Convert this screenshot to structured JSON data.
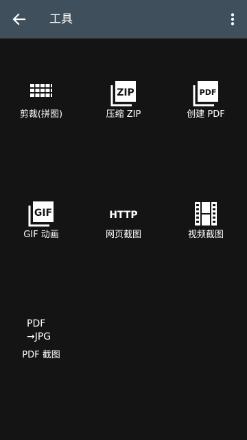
{
  "header": {
    "title": "工具"
  },
  "tools": [
    {
      "label": "剪裁(拼图)",
      "icon": "grid-icon"
    },
    {
      "label": "压缩 ZIP",
      "icon": "zip-icon",
      "badge": "ZIP"
    },
    {
      "label": "创建 PDF",
      "icon": "pdf-icon",
      "badge": "PDF"
    },
    {
      "label": "GIF 动画",
      "icon": "gif-icon",
      "badge": "GIF"
    },
    {
      "label": "网页截图",
      "icon": "http-icon",
      "badge": "HTTP"
    },
    {
      "label": "视频截图",
      "icon": "film-icon"
    },
    {
      "label": "PDF 截图",
      "icon": "pdf-to-jpg-icon",
      "icon_lines": [
        "PDF",
        "→JPG"
      ]
    }
  ]
}
